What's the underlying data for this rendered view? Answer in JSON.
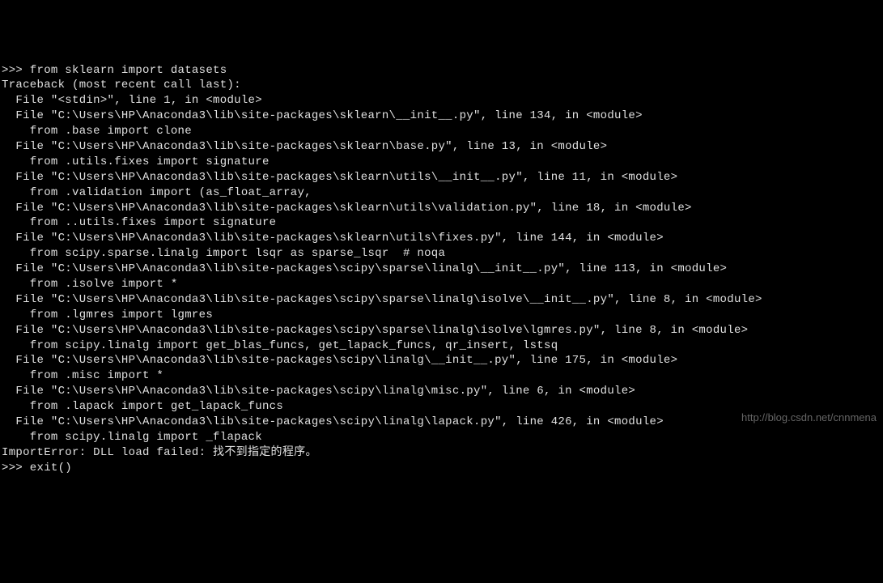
{
  "terminal": {
    "lines": [
      ">>> from sklearn import datasets",
      "Traceback (most recent call last):",
      "  File \"<stdin>\", line 1, in <module>",
      "  File \"C:\\Users\\HP\\Anaconda3\\lib\\site-packages\\sklearn\\__init__.py\", line 134, in <module>",
      "    from .base import clone",
      "  File \"C:\\Users\\HP\\Anaconda3\\lib\\site-packages\\sklearn\\base.py\", line 13, in <module>",
      "    from .utils.fixes import signature",
      "  File \"C:\\Users\\HP\\Anaconda3\\lib\\site-packages\\sklearn\\utils\\__init__.py\", line 11, in <module>",
      "    from .validation import (as_float_array,",
      "  File \"C:\\Users\\HP\\Anaconda3\\lib\\site-packages\\sklearn\\utils\\validation.py\", line 18, in <module>",
      "    from ..utils.fixes import signature",
      "  File \"C:\\Users\\HP\\Anaconda3\\lib\\site-packages\\sklearn\\utils\\fixes.py\", line 144, in <module>",
      "    from scipy.sparse.linalg import lsqr as sparse_lsqr  # noqa",
      "  File \"C:\\Users\\HP\\Anaconda3\\lib\\site-packages\\scipy\\sparse\\linalg\\__init__.py\", line 113, in <module>",
      "    from .isolve import *",
      "  File \"C:\\Users\\HP\\Anaconda3\\lib\\site-packages\\scipy\\sparse\\linalg\\isolve\\__init__.py\", line 8, in <module>",
      "    from .lgmres import lgmres",
      "  File \"C:\\Users\\HP\\Anaconda3\\lib\\site-packages\\scipy\\sparse\\linalg\\isolve\\lgmres.py\", line 8, in <module>",
      "    from scipy.linalg import get_blas_funcs, get_lapack_funcs, qr_insert, lstsq",
      "  File \"C:\\Users\\HP\\Anaconda3\\lib\\site-packages\\scipy\\linalg\\__init__.py\", line 175, in <module>",
      "    from .misc import *",
      "  File \"C:\\Users\\HP\\Anaconda3\\lib\\site-packages\\scipy\\linalg\\misc.py\", line 6, in <module>",
      "    from .lapack import get_lapack_funcs",
      "  File \"C:\\Users\\HP\\Anaconda3\\lib\\site-packages\\scipy\\linalg\\lapack.py\", line 426, in <module>",
      "    from scipy.linalg import _flapack",
      "ImportError: DLL load failed: 找不到指定的程序。",
      ">>> exit()"
    ]
  },
  "watermark": "http://blog.csdn.net/cnnmena"
}
